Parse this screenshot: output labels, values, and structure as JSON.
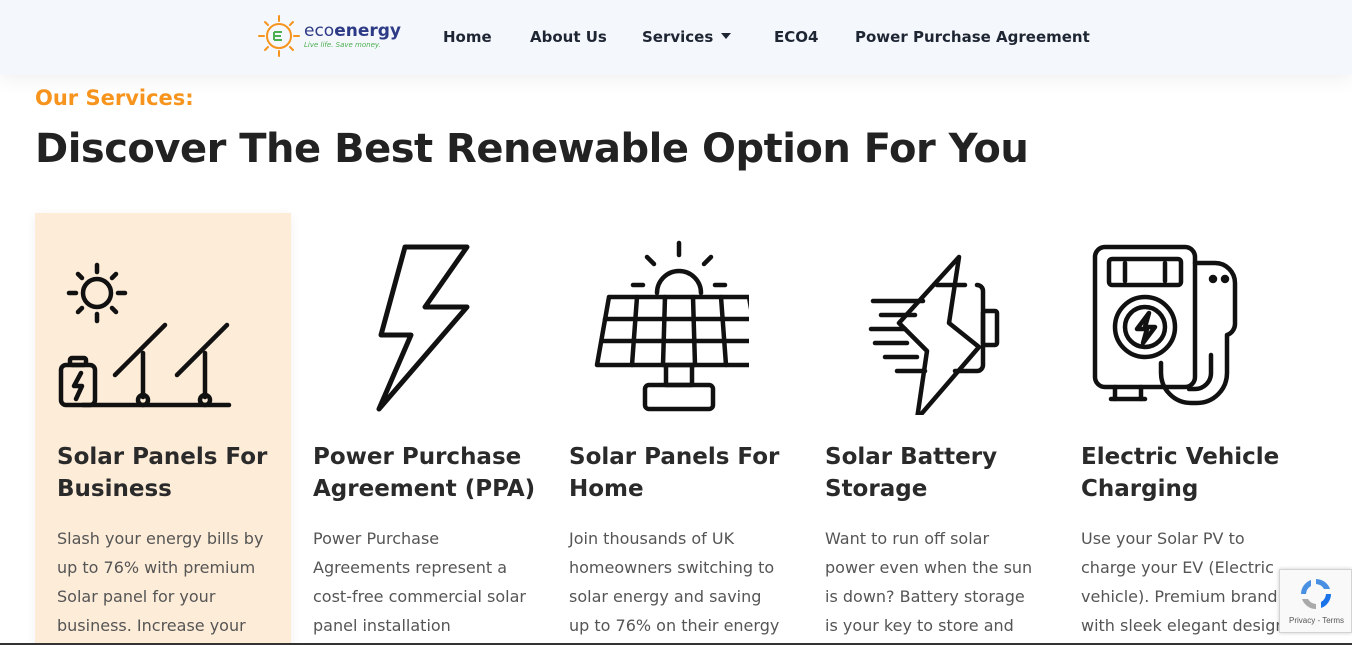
{
  "brand": {
    "name_part1": "eco",
    "name_part2": "energy",
    "tagline": "Live life. Save money."
  },
  "nav": {
    "items": [
      {
        "label": "Home"
      },
      {
        "label": "About Us"
      },
      {
        "label": "Services"
      },
      {
        "label": "ECO4"
      },
      {
        "label": "Power Purchase Agreement"
      }
    ]
  },
  "section": {
    "eyebrow": "Our Services:",
    "title": "Discover The Best Renewable Option For You"
  },
  "cards": [
    {
      "icon": "solar-business-icon",
      "title": "Solar Panels For Business",
      "desc": "Slash your energy bills by up to 76% with premium Solar panel for your business. Increase your"
    },
    {
      "icon": "lightning-bolt-icon",
      "title": "Power Purchase Agreement (PPA)",
      "desc": "Power Purchase Agreements represent a cost-free commercial solar panel installation"
    },
    {
      "icon": "solar-panel-icon",
      "title": "Solar Panels For Home",
      "desc": "Join thousands of UK homeowners switching to solar energy and saving up to 76% on their energy"
    },
    {
      "icon": "battery-charge-icon",
      "title": "Solar Battery Storage",
      "desc": "Want to run off solar power even when the sun is down? Battery storage is your key to store and"
    },
    {
      "icon": "ev-charger-icon",
      "title": "Electric Vehicle Charging",
      "desc": "Use your Solar PV to charge your EV (Electric vehicle). Premium brand with sleek elegant design,"
    }
  ],
  "recaptcha": {
    "links": "Privacy - Terms"
  },
  "colors": {
    "accent": "#f7941d",
    "header_bg": "#f4f7fc",
    "active_card_bg": "#fdecd8",
    "text_dark": "#222222"
  }
}
